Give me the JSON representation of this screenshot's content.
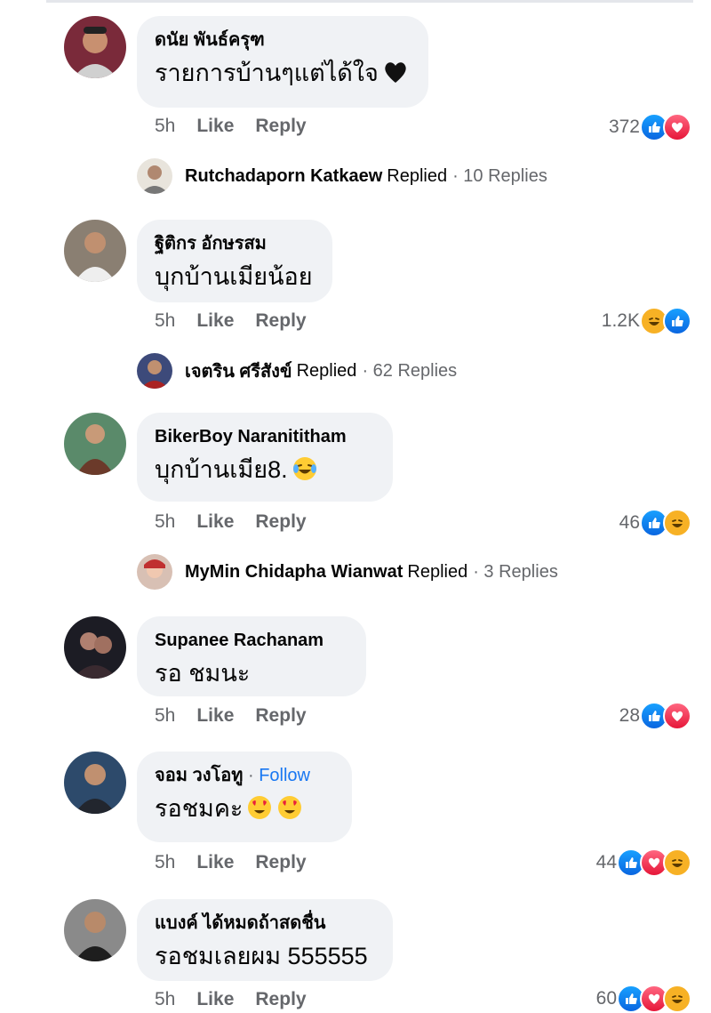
{
  "comments": [
    {
      "author": "ดนัย พันธ์ครุฑ",
      "text": "รายการบ้านๆแต่ได้ใจ",
      "text_emoji": "black-heart",
      "time": "5h",
      "like_label": "Like",
      "reply_label": "Reply",
      "reaction_count": "372",
      "reactions": [
        "like",
        "love"
      ],
      "avatar_color": "#7a2a3a",
      "replies": {
        "name": "Rutchadaporn Katkaew",
        "word": "Replied",
        "count": "· 10 Replies",
        "avatar_color": "#b8b0a2"
      }
    },
    {
      "author": "ฐิติกร อักษรสม",
      "text": "บุกบ้านเมียน้อย",
      "time": "5h",
      "like_label": "Like",
      "reply_label": "Reply",
      "reaction_count": "1.2K",
      "reactions": [
        "haha",
        "like"
      ],
      "avatar_color": "#6b5a4e",
      "replies": {
        "name": "เจตริน ศรีสังข์",
        "word": "Replied",
        "count": "· 62 Replies",
        "avatar_color": "#3d4a7a"
      }
    },
    {
      "author": "BikerBoy Naranititham",
      "text": "บุกบ้านเมีย8.",
      "text_emoji": "joy",
      "time": "5h",
      "like_label": "Like",
      "reply_label": "Reply",
      "reaction_count": "46",
      "reactions": [
        "like",
        "haha"
      ],
      "avatar_color": "#4a7a5a",
      "replies": {
        "name": "MyMin Chidapha Wianwat",
        "word": "Replied",
        "count": "· 3 Replies",
        "avatar_color": "#c9a393"
      }
    },
    {
      "author": "Supanee Rachanam",
      "text": "รอ ชมนะ",
      "time": "5h",
      "like_label": "Like",
      "reply_label": "Reply",
      "reaction_count": "28",
      "reactions": [
        "like",
        "love"
      ],
      "avatar_color": "#1c1c24"
    },
    {
      "author": "จอม วงโอทู",
      "follow": "Follow",
      "text": "รอชมคะ",
      "text_emoji": "heart-eyes-x2",
      "time": "5h",
      "like_label": "Like",
      "reply_label": "Reply",
      "reaction_count": "44",
      "reactions": [
        "like",
        "love",
        "haha"
      ],
      "avatar_color": "#2d4a6b"
    },
    {
      "author": "แบงค์ ได้หมดถ้าสดชื่น",
      "text": "รอชมเลยผม 555555",
      "time": "5h",
      "like_label": "Like",
      "reply_label": "Reply",
      "reaction_count": "60",
      "reactions": [
        "like",
        "love",
        "haha"
      ],
      "avatar_color": "#3a3030"
    }
  ],
  "colors": {
    "bubble": "#f0f2f5",
    "meta": "#65676b",
    "link": "#1877f2",
    "like": "#1877f2",
    "love": "#f02849",
    "haha": "#f7b125"
  }
}
